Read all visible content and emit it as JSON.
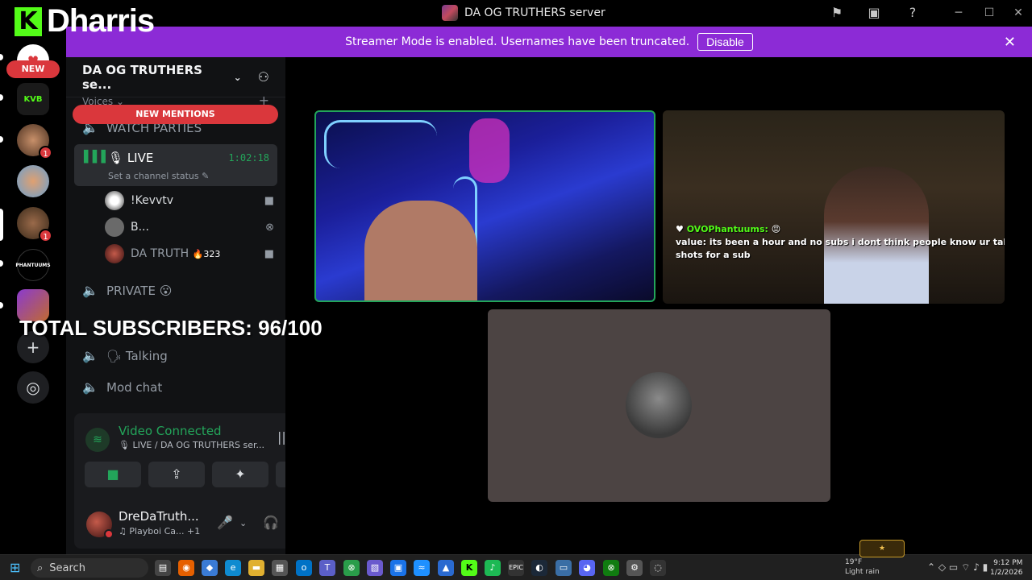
{
  "window": {
    "title": "DA OG TRUTHERS server"
  },
  "overlay": {
    "brand_letter": "K",
    "brand_name": "Dharris",
    "subscribers": "TOTAL SUBSCRIBERS: 96/100"
  },
  "banner": {
    "text": "Streamer Mode is enabled. Usernames have been truncated.",
    "button": "Disable"
  },
  "rail": {
    "new_pill": "NEW",
    "servers": [
      {
        "label": "",
        "badge": ""
      },
      {
        "label": "KVB",
        "badge": ""
      },
      {
        "label": "",
        "badge": "1"
      },
      {
        "label": "",
        "badge": ""
      },
      {
        "label": "",
        "badge": "1"
      },
      {
        "label": "PHANTUUMS",
        "badge": ""
      },
      {
        "label": "",
        "badge": ""
      }
    ]
  },
  "channels": {
    "server_name": "DA OG TRUTHERS se...",
    "category": "Voices",
    "new_mentions": "NEW MENTIONS",
    "watch_parties": "WATCH PARTIES",
    "live": {
      "name": "LIVE",
      "time": "1:02:18",
      "status": "Set a channel status"
    },
    "members": [
      {
        "name": "!Kevvtv",
        "extra": ""
      },
      {
        "name": "B...",
        "extra": ""
      },
      {
        "name": "DA TRUTH",
        "extra": "323"
      }
    ],
    "private": "PRIVATE",
    "talking": "Talking",
    "mod_chat": "Mod chat"
  },
  "voice": {
    "title": "Video Connected",
    "subtitle": "LIVE / DA OG TRUTHERS ser..."
  },
  "user": {
    "name": "DreDaTruth...",
    "activity": "Playboi Ca...",
    "activity_extra": "+1"
  },
  "stage": {
    "chat": {
      "user1": "OVOPhantuums:",
      "user2": "value:",
      "message": "its been a hour and no subs i dont think people know ur taking shots for a sub"
    }
  },
  "taskbar": {
    "search": "Search",
    "weather_temp": "19°F",
    "weather_desc": "Light rain",
    "time": "9:12 PM",
    "date": "1/2/2026"
  },
  "colors": {
    "banner": "#8c2bd6",
    "kick_green": "#53fc18",
    "discord_red": "#da373c",
    "connected_green": "#23a55a"
  }
}
